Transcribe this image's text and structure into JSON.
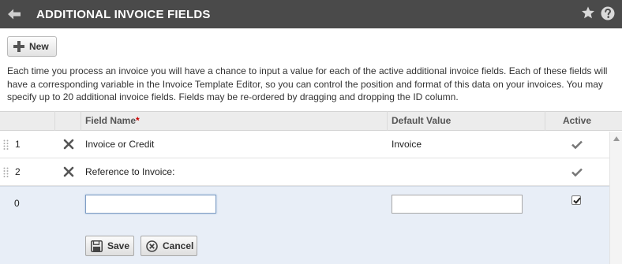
{
  "header": {
    "title": "ADDITIONAL INVOICE FIELDS",
    "icons": [
      "back-arrow-icon",
      "star-icon",
      "help-icon"
    ]
  },
  "toolbar": {
    "new_label": "New"
  },
  "description": "Each time you process an invoice you will have a chance to input a value for each of the active additional invoice fields. Each of these fields will have a corresponding variable in the Invoice Template Editor, so you can control the position and format of this data on your invoices. You may specify up to 20 additional invoice fields. Fields may be re-ordered by dragging and dropping the ID column.",
  "table": {
    "columns": {
      "field_name": "Field Name",
      "required_marker": "*",
      "default_value": "Default Value",
      "active": "Active"
    },
    "rows": [
      {
        "id": "1",
        "field_name": "Invoice or Credit",
        "default_value": "Invoice",
        "active": true
      },
      {
        "id": "2",
        "field_name": "Reference to Invoice:",
        "default_value": "",
        "active": true
      }
    ],
    "edit_row": {
      "id": "0",
      "field_name_value": "",
      "default_value_value": "",
      "active_checked": true,
      "save_label": "Save",
      "cancel_label": "Cancel"
    }
  },
  "colors": {
    "title_bar": "#4a4a4a",
    "header_row": "#ececec",
    "edit_row": "#e8eef7",
    "required": "#cc0000"
  }
}
